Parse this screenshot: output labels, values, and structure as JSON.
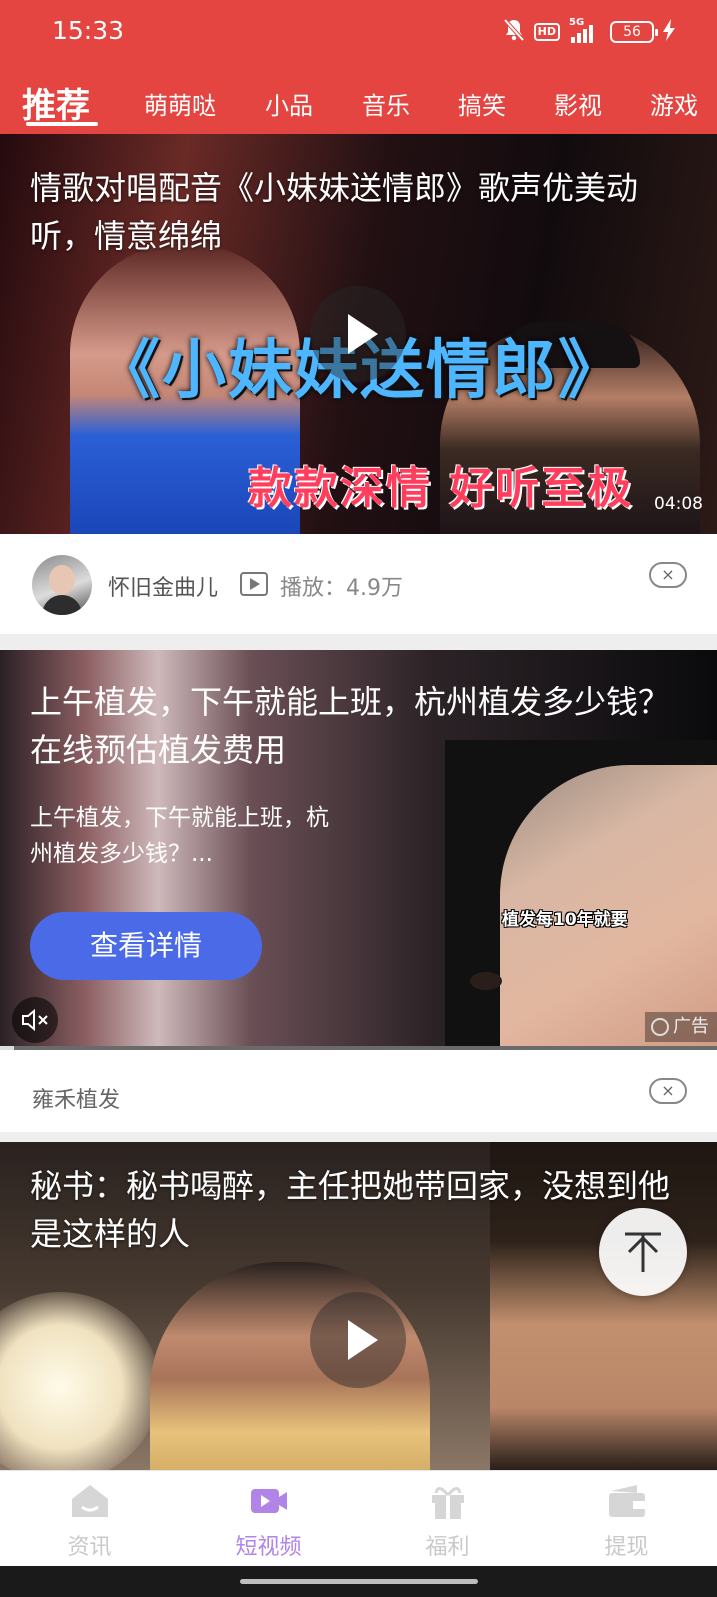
{
  "status_bar": {
    "time": "15:33",
    "hd_label": "HD",
    "network_label": "5G",
    "battery_level": "56"
  },
  "nav_tabs": {
    "active": "推荐",
    "items": [
      "萌萌哒",
      "小品",
      "音乐",
      "搞笑",
      "影视",
      "游戏"
    ]
  },
  "feed": {
    "video1": {
      "title": "情歌对唱配音《小妹妹送情郎》歌声优美动听，情意绵绵",
      "overlay_text_1": "《小妹妹送情郎》",
      "overlay_text_2": "款款深情 好听至极",
      "duration": "04:08",
      "author": "怀旧金曲儿",
      "play_count": "播放：4.9万",
      "close_symbol": "×"
    },
    "ad": {
      "title": "上午植发，下午就能上班，杭州植发多少钱？在线预估植发费用",
      "description": "上午植发，下午就能上班，杭州植发多少钱？...",
      "cta": "查看详情",
      "image_caption": "植发每10年就要",
      "ad_label": "广告",
      "advertiser": "雍禾植发",
      "close_symbol": "×",
      "progress_fraction": 0.02
    },
    "video2": {
      "title": "秘书：秘书喝醉，主任把她带回家，没想到他是这样的人"
    }
  },
  "back_to_top_icon": "arrow-to-top-icon",
  "bottom_nav": {
    "items": [
      {
        "label": "资讯",
        "icon": "home-icon"
      },
      {
        "label": "短视频",
        "icon": "video-camera-icon"
      },
      {
        "label": "福利",
        "icon": "gift-icon"
      },
      {
        "label": "提现",
        "icon": "wallet-icon"
      }
    ],
    "active_index": 1
  },
  "colors": {
    "brand_red": "#e44541",
    "cta_blue": "#4a6ae8",
    "nav_active": "#b184e8",
    "nav_inactive": "#c9c9c9"
  }
}
